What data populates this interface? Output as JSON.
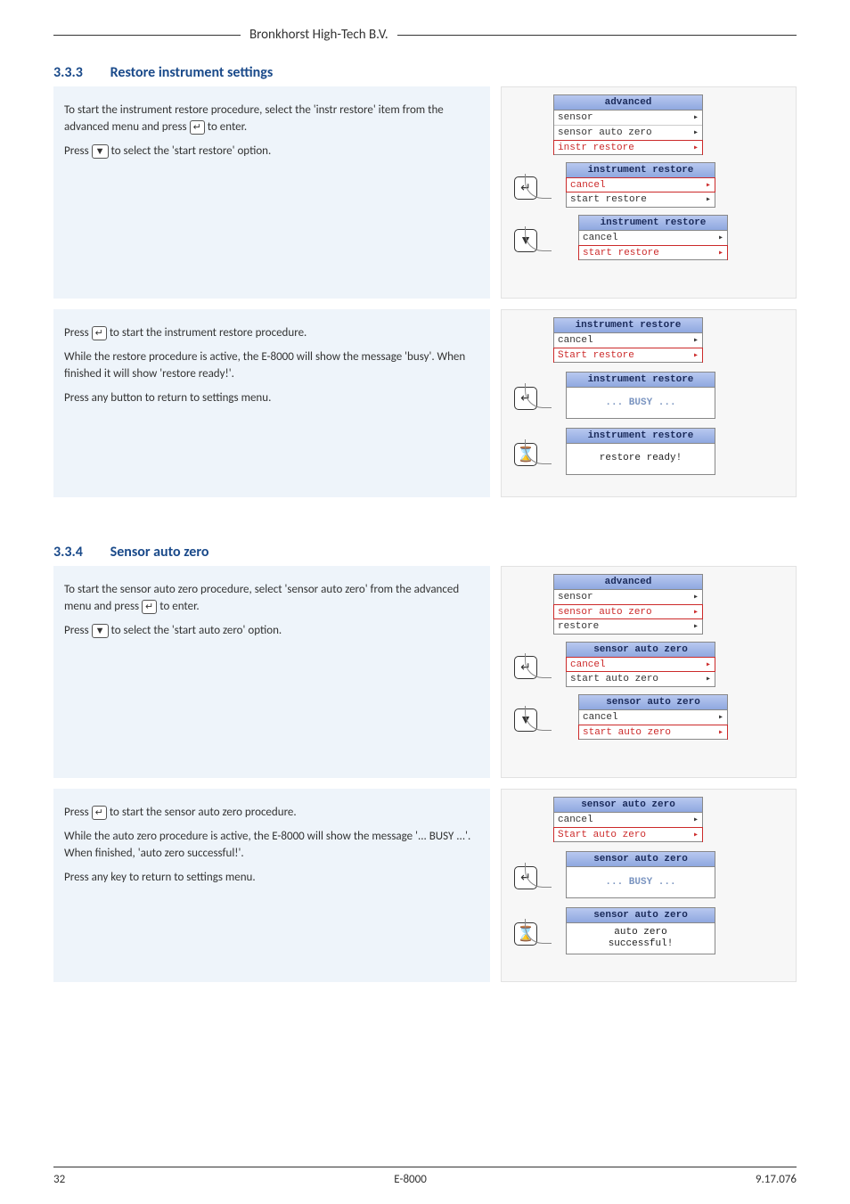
{
  "header": {
    "company": "Bronkhorst High-Tech B.V."
  },
  "sec1": {
    "num": "3.3.3",
    "title": "Restore instrument settings",
    "p1a": {
      "text1": "To start the instrument restore procedure, select the 'instr restore' item from the advanced menu and press ",
      "key": "↵",
      "text2": " to enter.",
      "text3": "Press ",
      "key2": "▼",
      "text4": " to select the 'start restore' option."
    },
    "p1b": {
      "text1": "Press ",
      "key": "↵",
      "text2": " to start the instrument restore procedure.",
      "text3": "While the restore procedure is active, the E-8000 will show the message 'busy'. When finished it will show 'restore ready!'.",
      "text4": "Press any button to return to settings menu."
    },
    "lcd1": {
      "title": "advanced",
      "r1": "sensor",
      "r2": "sensor auto zero",
      "r3": "instr restore"
    },
    "lcd2": {
      "title": "instrument restore",
      "r1": "cancel",
      "r2": "start restore"
    },
    "lcd3": {
      "title": "instrument restore",
      "r1": "cancel",
      "r2": "start restore"
    },
    "lcd4": {
      "title": "instrument restore",
      "r1": "cancel",
      "r2": "Start restore"
    },
    "lcd5": {
      "title": "instrument restore",
      "busy": "... BUSY ..."
    },
    "lcd6": {
      "title": "instrument restore",
      "msg": "restore ready!"
    }
  },
  "sec2": {
    "num": "3.3.4",
    "title": "Sensor auto zero",
    "p1a": {
      "text1": "To start the sensor auto zero procedure, select 'sensor auto zero' from the advanced menu and press ",
      "key": "↵",
      "text2": " to enter.",
      "text3": "Press ",
      "key2": "▼",
      "text4": " to select the 'start auto zero' option."
    },
    "p1b": {
      "text1": "Press ",
      "key": "↵",
      "text2": " to start the sensor auto zero procedure.",
      "text3": "While the auto zero procedure is active, the E-8000 will show the message '... BUSY ...'. When finished, 'auto zero successful!'.",
      "text4": "Press any key to return to settings menu."
    },
    "lcd1": {
      "title": "advanced",
      "r1": "sensor",
      "r2": "sensor auto zero",
      "r3": "restore"
    },
    "lcd2": {
      "title": "sensor auto zero",
      "r1": "cancel",
      "r2": "start auto zero"
    },
    "lcd3": {
      "title": "sensor auto zero",
      "r1": "cancel",
      "r2": "start auto zero"
    },
    "lcd4": {
      "title": "sensor auto zero",
      "r1": "cancel",
      "r2": "Start auto zero"
    },
    "lcd5": {
      "title": "sensor auto zero",
      "busy": "... BUSY ..."
    },
    "lcd6": {
      "title": "sensor auto zero",
      "msg1": "auto zero",
      "msg2": "successful!"
    }
  },
  "footer": {
    "page": "32",
    "product": "E-8000",
    "doc": "9.17.076"
  },
  "keys": {
    "enter": "↵",
    "down": "▼",
    "hourglass": "⌛"
  }
}
